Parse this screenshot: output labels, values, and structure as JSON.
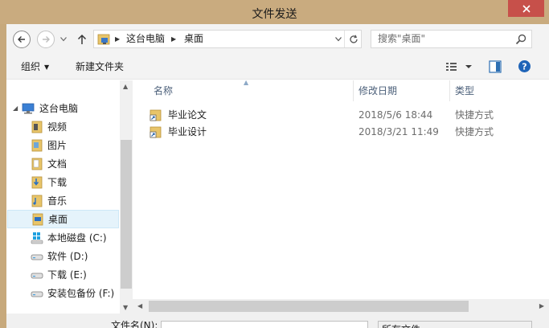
{
  "window": {
    "title": "文件发送"
  },
  "address": {
    "crumbs": [
      "这台电脑",
      "桌面"
    ]
  },
  "search": {
    "placeholder": "搜索\"桌面\""
  },
  "toolbar": {
    "organize": "组织",
    "new_folder": "新建文件夹"
  },
  "nav": {
    "items": [
      {
        "label": "这台电脑",
        "icon": "computer-icon"
      },
      {
        "label": "视频",
        "icon": "videos-folder-icon"
      },
      {
        "label": "图片",
        "icon": "pictures-folder-icon"
      },
      {
        "label": "文档",
        "icon": "documents-folder-icon"
      },
      {
        "label": "下载",
        "icon": "downloads-folder-icon"
      },
      {
        "label": "音乐",
        "icon": "music-folder-icon"
      },
      {
        "label": "桌面",
        "icon": "desktop-folder-icon"
      },
      {
        "label": "本地磁盘 (C:)",
        "icon": "system-drive-icon"
      },
      {
        "label": "软件 (D:)",
        "icon": "drive-icon"
      },
      {
        "label": "下载 (E:)",
        "icon": "drive-icon"
      },
      {
        "label": "安装包备份 (F:)",
        "icon": "drive-icon"
      }
    ]
  },
  "columns": {
    "name": "名称",
    "date": "修改日期",
    "type": "类型"
  },
  "files": [
    {
      "name": "毕业论文",
      "date": "2018/5/6 18:44",
      "type": "快捷方式"
    },
    {
      "name": "毕业设计",
      "date": "2018/3/21 11:49",
      "type": "快捷方式"
    }
  ],
  "bottom": {
    "filename_label": "文件名(N):",
    "filter": "所有文件"
  },
  "colors": {
    "title_bar": "#c9ab7f",
    "close_button": "#c7504a",
    "selection": "#e5f3fb",
    "column_header": "#4c607a"
  }
}
